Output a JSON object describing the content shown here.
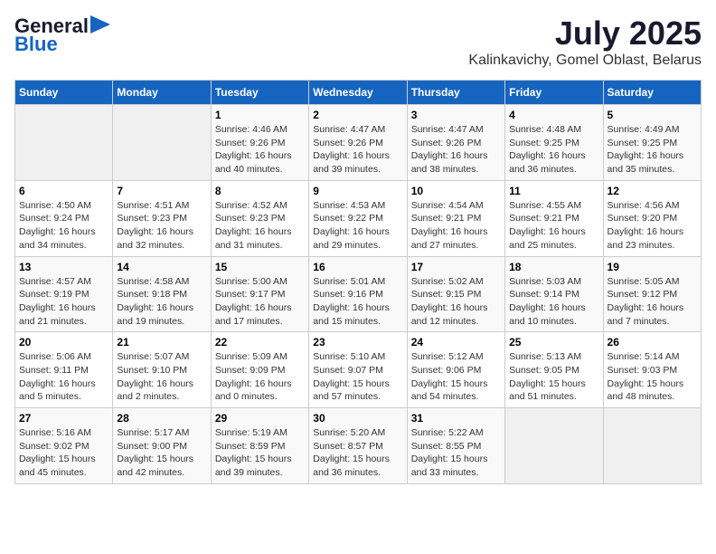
{
  "header": {
    "logo_general": "General",
    "logo_blue": "Blue",
    "title": "July 2025",
    "subtitle": "Kalinkavichy, Gomel Oblast, Belarus"
  },
  "days_of_week": [
    "Sunday",
    "Monday",
    "Tuesday",
    "Wednesday",
    "Thursday",
    "Friday",
    "Saturday"
  ],
  "weeks": [
    [
      {
        "day": "",
        "info": ""
      },
      {
        "day": "",
        "info": ""
      },
      {
        "day": "1",
        "info": "Sunrise: 4:46 AM\nSunset: 9:26 PM\nDaylight: 16 hours\nand 40 minutes."
      },
      {
        "day": "2",
        "info": "Sunrise: 4:47 AM\nSunset: 9:26 PM\nDaylight: 16 hours\nand 39 minutes."
      },
      {
        "day": "3",
        "info": "Sunrise: 4:47 AM\nSunset: 9:26 PM\nDaylight: 16 hours\nand 38 minutes."
      },
      {
        "day": "4",
        "info": "Sunrise: 4:48 AM\nSunset: 9:25 PM\nDaylight: 16 hours\nand 36 minutes."
      },
      {
        "day": "5",
        "info": "Sunrise: 4:49 AM\nSunset: 9:25 PM\nDaylight: 16 hours\nand 35 minutes."
      }
    ],
    [
      {
        "day": "6",
        "info": "Sunrise: 4:50 AM\nSunset: 9:24 PM\nDaylight: 16 hours\nand 34 minutes."
      },
      {
        "day": "7",
        "info": "Sunrise: 4:51 AM\nSunset: 9:23 PM\nDaylight: 16 hours\nand 32 minutes."
      },
      {
        "day": "8",
        "info": "Sunrise: 4:52 AM\nSunset: 9:23 PM\nDaylight: 16 hours\nand 31 minutes."
      },
      {
        "day": "9",
        "info": "Sunrise: 4:53 AM\nSunset: 9:22 PM\nDaylight: 16 hours\nand 29 minutes."
      },
      {
        "day": "10",
        "info": "Sunrise: 4:54 AM\nSunset: 9:21 PM\nDaylight: 16 hours\nand 27 minutes."
      },
      {
        "day": "11",
        "info": "Sunrise: 4:55 AM\nSunset: 9:21 PM\nDaylight: 16 hours\nand 25 minutes."
      },
      {
        "day": "12",
        "info": "Sunrise: 4:56 AM\nSunset: 9:20 PM\nDaylight: 16 hours\nand 23 minutes."
      }
    ],
    [
      {
        "day": "13",
        "info": "Sunrise: 4:57 AM\nSunset: 9:19 PM\nDaylight: 16 hours\nand 21 minutes."
      },
      {
        "day": "14",
        "info": "Sunrise: 4:58 AM\nSunset: 9:18 PM\nDaylight: 16 hours\nand 19 minutes."
      },
      {
        "day": "15",
        "info": "Sunrise: 5:00 AM\nSunset: 9:17 PM\nDaylight: 16 hours\nand 17 minutes."
      },
      {
        "day": "16",
        "info": "Sunrise: 5:01 AM\nSunset: 9:16 PM\nDaylight: 16 hours\nand 15 minutes."
      },
      {
        "day": "17",
        "info": "Sunrise: 5:02 AM\nSunset: 9:15 PM\nDaylight: 16 hours\nand 12 minutes."
      },
      {
        "day": "18",
        "info": "Sunrise: 5:03 AM\nSunset: 9:14 PM\nDaylight: 16 hours\nand 10 minutes."
      },
      {
        "day": "19",
        "info": "Sunrise: 5:05 AM\nSunset: 9:12 PM\nDaylight: 16 hours\nand 7 minutes."
      }
    ],
    [
      {
        "day": "20",
        "info": "Sunrise: 5:06 AM\nSunset: 9:11 PM\nDaylight: 16 hours\nand 5 minutes."
      },
      {
        "day": "21",
        "info": "Sunrise: 5:07 AM\nSunset: 9:10 PM\nDaylight: 16 hours\nand 2 minutes."
      },
      {
        "day": "22",
        "info": "Sunrise: 5:09 AM\nSunset: 9:09 PM\nDaylight: 16 hours\nand 0 minutes."
      },
      {
        "day": "23",
        "info": "Sunrise: 5:10 AM\nSunset: 9:07 PM\nDaylight: 15 hours\nand 57 minutes."
      },
      {
        "day": "24",
        "info": "Sunrise: 5:12 AM\nSunset: 9:06 PM\nDaylight: 15 hours\nand 54 minutes."
      },
      {
        "day": "25",
        "info": "Sunrise: 5:13 AM\nSunset: 9:05 PM\nDaylight: 15 hours\nand 51 minutes."
      },
      {
        "day": "26",
        "info": "Sunrise: 5:14 AM\nSunset: 9:03 PM\nDaylight: 15 hours\nand 48 minutes."
      }
    ],
    [
      {
        "day": "27",
        "info": "Sunrise: 5:16 AM\nSunset: 9:02 PM\nDaylight: 15 hours\nand 45 minutes."
      },
      {
        "day": "28",
        "info": "Sunrise: 5:17 AM\nSunset: 9:00 PM\nDaylight: 15 hours\nand 42 minutes."
      },
      {
        "day": "29",
        "info": "Sunrise: 5:19 AM\nSunset: 8:59 PM\nDaylight: 15 hours\nand 39 minutes."
      },
      {
        "day": "30",
        "info": "Sunrise: 5:20 AM\nSunset: 8:57 PM\nDaylight: 15 hours\nand 36 minutes."
      },
      {
        "day": "31",
        "info": "Sunrise: 5:22 AM\nSunset: 8:55 PM\nDaylight: 15 hours\nand 33 minutes."
      },
      {
        "day": "",
        "info": ""
      },
      {
        "day": "",
        "info": ""
      }
    ]
  ]
}
